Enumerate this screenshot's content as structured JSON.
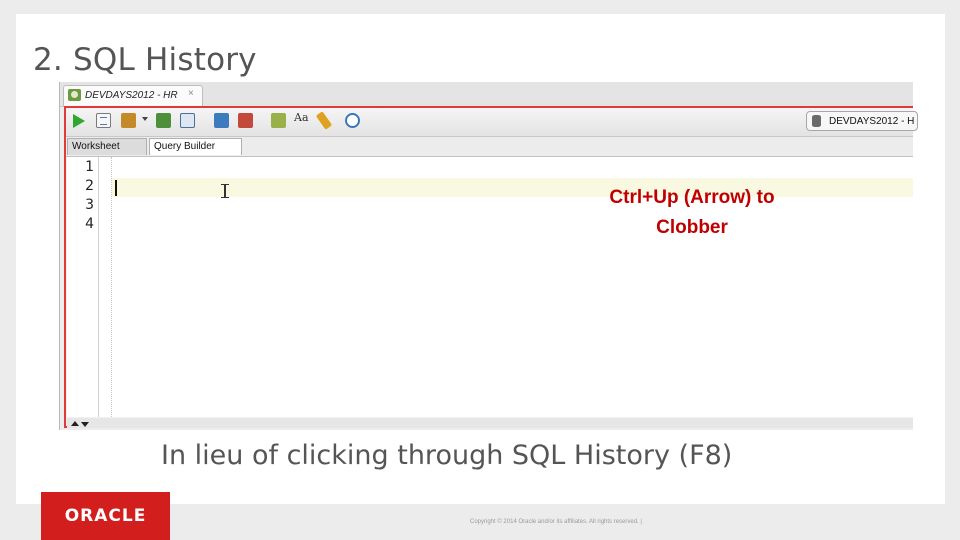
{
  "slide": {
    "title": "2. SQL History",
    "caption": "In lieu of clicking through SQL History (F8)",
    "copyright": "Copyright © 2014 Oracle and/or its affiliates. All rights reserved.  |",
    "logo_text": "ORACLE"
  },
  "editor": {
    "tab_label": "DEVDAYS2012 - HR",
    "tab_close": "×",
    "connection_label": "DEVDAYS2012 - H",
    "subtabs": [
      "Worksheet",
      "Query Builder"
    ],
    "line_numbers": [
      "1",
      "2",
      "3",
      "4"
    ],
    "toolbar_icons": [
      "run-statement-icon",
      "run-script-icon",
      "autotrace-icon",
      "explain-plan-icon",
      "commit-icon",
      "rollback-icon",
      "sql-tuning-icon",
      "unshared-sql-icon",
      "format-icon",
      "clear-icon",
      "sql-history-icon"
    ],
    "toolbar_aa": "Aa"
  },
  "callout": {
    "line1": "Ctrl+Up (Arrow) to",
    "line2": "Clobber"
  },
  "colors": {
    "accent_red": "#c00000",
    "frame_red": "#e03a3a",
    "oracle_red": "#d31e1e"
  }
}
